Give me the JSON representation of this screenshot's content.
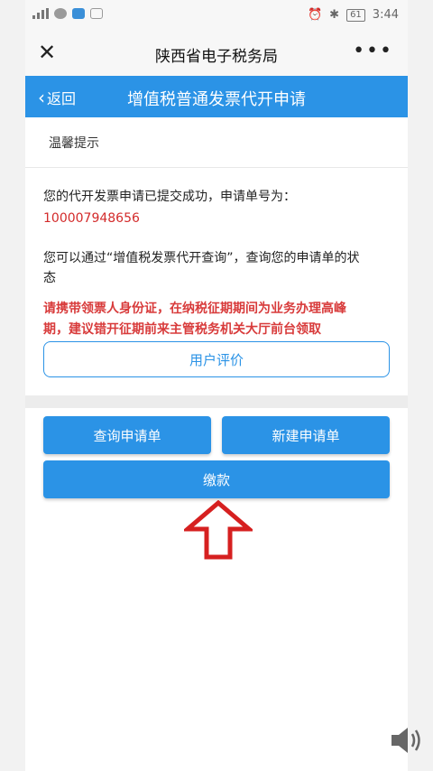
{
  "status_bar": {
    "time": "3:44",
    "battery": "61"
  },
  "titlebar": {
    "title": "陕西省电子税务局"
  },
  "header": {
    "back_label": "返回",
    "title": "增值税普通发票代开申请"
  },
  "content": {
    "tip_label": "温馨提示",
    "success_text": "您的代开发票申请已提交成功，申请单号为：",
    "application_number": "100007948656",
    "query_text_line1": "您可以通过“增值税发票代开查询”，查询您的申请单的状",
    "query_text_line2": "态",
    "warning_line1": "请携带领票人身份证，在纳税征期期间为业务办理高峰",
    "warning_line2": "期，建议错开征期前来主管税务机关大厅前台领取"
  },
  "buttons": {
    "rate": "用户评价",
    "query": "查询申请单",
    "new": "新建申请单",
    "pay": "缴款"
  },
  "colors": {
    "accent": "#2b93e6",
    "warning": "#d83b3b",
    "arrow": "#d62020"
  }
}
